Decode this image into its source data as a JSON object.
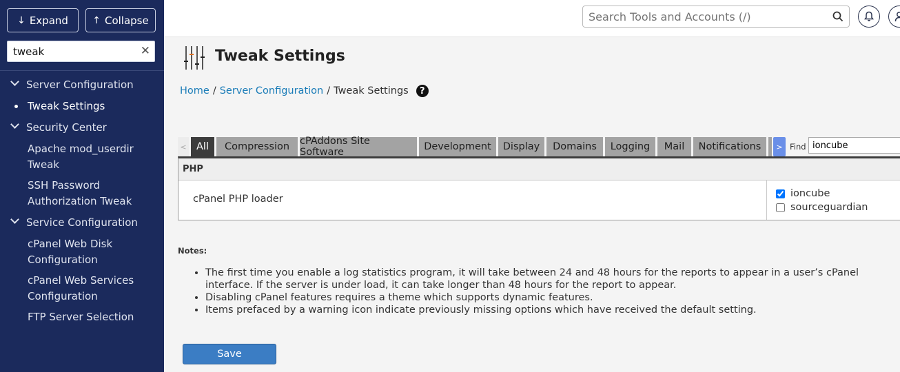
{
  "sidebar": {
    "expand_label": "Expand",
    "collapse_label": "Collapse",
    "search_value": "tweak",
    "categories": [
      {
        "label": "Server Configuration",
        "items": [
          {
            "label": "Tweak Settings",
            "active": true
          }
        ]
      },
      {
        "label": "Security Center",
        "items": [
          {
            "label": "Apache mod_userdir Tweak"
          },
          {
            "label": "SSH Password Authorization Tweak"
          }
        ]
      },
      {
        "label": "Service Configuration",
        "items": [
          {
            "label": "cPanel Web Disk Configuration"
          },
          {
            "label": "cPanel Web Services Configuration"
          },
          {
            "label": "FTP Server Selection"
          }
        ]
      }
    ]
  },
  "topbar": {
    "search_placeholder": "Search Tools and Accounts (/)"
  },
  "page": {
    "title": "Tweak Settings",
    "breadcrumb": {
      "home": "Home",
      "sep": "/",
      "section": "Server Configuration",
      "current": "Tweak Settings"
    },
    "help": "?"
  },
  "tabs": {
    "prev": "<",
    "next": ">",
    "items": [
      "All",
      "Compression",
      "cPAddons Site Software",
      "Development",
      "Display",
      "Domains",
      "Logging",
      "Mail",
      "Notifications"
    ],
    "active": "All",
    "find_label": "Find",
    "find_value": "ioncube"
  },
  "settings": {
    "section": "PHP",
    "row_label": "cPanel PHP loader",
    "options": [
      {
        "label": "ioncube",
        "checked": true
      },
      {
        "label": "sourceguardian",
        "checked": false
      }
    ]
  },
  "notes": {
    "title": "Notes:",
    "items": [
      "The first time you enable a log statistics program, it will take between 24 and 48 hours for the reports to appear in a user’s cPanel interface. If the server is under load, it can take longer than 48 hours for the report to appear.",
      "Disabling cPanel features requires a theme which supports dynamic features.",
      "Items prefaced by a warning icon indicate previously missing options which have received the default setting."
    ]
  },
  "save_label": "Save"
}
